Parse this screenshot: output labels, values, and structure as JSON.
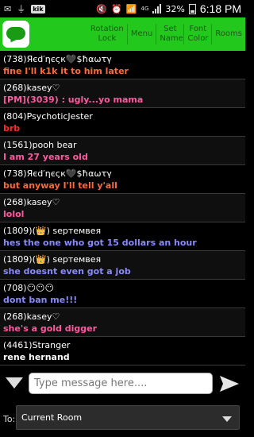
{
  "status_bar": {
    "kik_label": "kik",
    "battery": "32%",
    "network": "4G",
    "time": "6:18 PM"
  },
  "toolbar": {
    "rotation_lock": "Rotation Lock",
    "menu": "Menu",
    "set_name": "Set Name",
    "font_color": "Font Color",
    "rooms": "Rooms"
  },
  "messages": [
    {
      "user": "(738)Яєd′ηєςк🖤$ħαωτγ",
      "text": "fine I'll k1k it to him later",
      "color": "#ff6a3a"
    },
    {
      "user": "(268)kasey♡",
      "text": "[PM](3039) : ugly...yo mama",
      "color": "#ff5aa0"
    },
    {
      "user": "(804)PsychoticJester",
      "text": "brb",
      "color": "#ff2a2a"
    },
    {
      "user": "(1561)pooh bear",
      "text": "I am 27 years old",
      "color": "#ff5aa0"
    },
    {
      "user": "(738)Яєd′ηєςк🖤$ħαωτγ",
      "text": "but anyway I'll tell y'all",
      "color": "#ff6a3a"
    },
    {
      "user": "(268)kasey♡",
      "text": "lolol",
      "color": "#ff5aa0"
    },
    {
      "user": "(1809)(👑) ѕертемвея",
      "text": "hes the one who got 15 dollars an hour",
      "color": "#8a8aff"
    },
    {
      "user": "(1809)(👑) ѕертемвея",
      "text": "she doesnt even got a job",
      "color": "#8a8aff"
    },
    {
      "user": "(708)😶😶😶",
      "text": "dont ban me!!!",
      "color": "#8a8aff"
    },
    {
      "user": "(268)kasey♡",
      "text": "she's a gold digger",
      "color": "#ff5aa0"
    },
    {
      "user": "(4461)Stranger",
      "text": "rene hernand",
      "color": "#ffffff"
    }
  ],
  "composer": {
    "placeholder": "Type message here...."
  },
  "recipient": {
    "label": "To:",
    "value": "Current Room"
  }
}
